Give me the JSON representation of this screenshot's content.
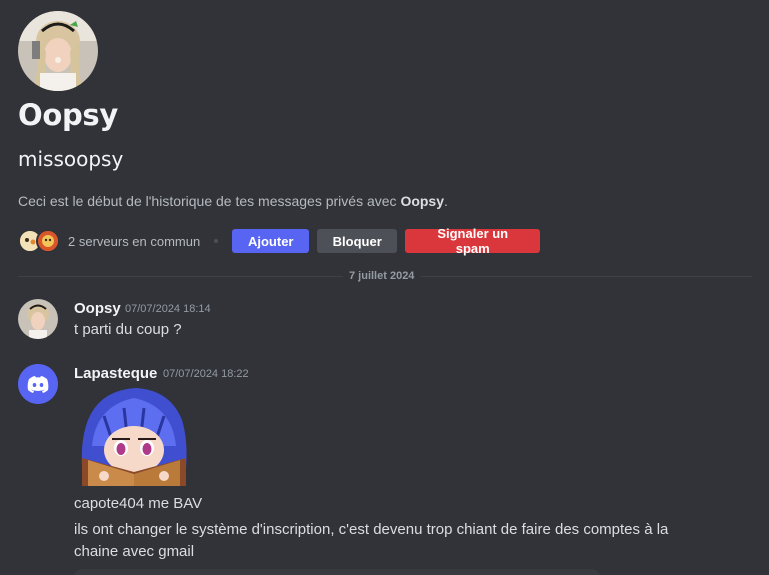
{
  "profile": {
    "display_name": "Oopsy",
    "username": "missoopsy",
    "intro_prefix": "Ceci est le début de l'historique de tes messages privés avec ",
    "intro_name": "Oopsy",
    "intro_suffix": ".",
    "mutual_servers": "2 serveurs en commun",
    "avatar_icon": "profile-photo-avatar"
  },
  "actions": {
    "add_label": "Ajouter",
    "block_label": "Bloquer",
    "report_label": "Signaler un spam"
  },
  "date_divider": "7 juillet 2024",
  "messages": [
    {
      "author": "Oopsy",
      "time": "07/07/2024 18:14",
      "lines": [
        "t parti du coup ?"
      ]
    },
    {
      "author": "Lapasteque",
      "time": "07/07/2024 18:22",
      "sticker": "anime-girl-reading-book-sticker",
      "lines": [
        "capote404 me BAV",
        "ils ont changer le système d'inscription, c'est devenu trop chiant de faire des comptes à la",
        "chaine avec gmail"
      ]
    }
  ],
  "colors": {
    "background": "#313338",
    "blurple": "#5865f2",
    "secondary_button": "#4e5058",
    "danger": "#da373c"
  }
}
